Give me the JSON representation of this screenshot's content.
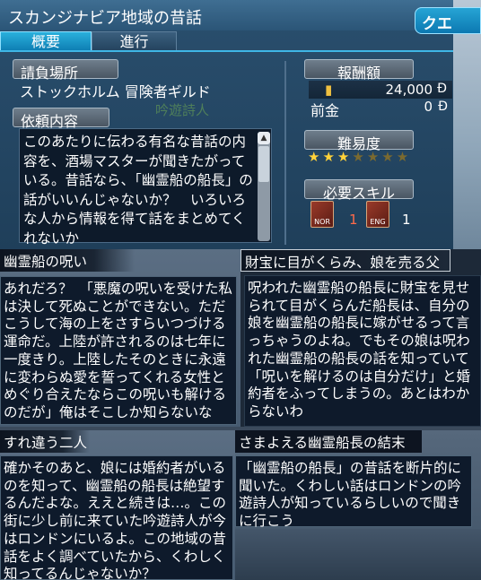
{
  "quest_window": {
    "title": "スカンジナビア地域の昔話",
    "side_tab": "クエ",
    "tabs": {
      "overview": "概要",
      "progress": "進行"
    },
    "client_location_label": "請負場所",
    "client_location": "ストックホルム  冒険者ギルド",
    "request_content_label": "依頼内容",
    "npc_name": "吟遊詩人",
    "description": "このあたりに伝わる有名な昔話の内容を、酒場マスターが聞きたがっている。昔話なら、「幽霊船の船長」の話がいいんじゃないか？　いろいろな人から情報を得て話をまとめてくれないか",
    "reward_label": "報酬額",
    "reward_value": "24,000",
    "advance_label": "前金",
    "advance_value": "0",
    "currency_symbol": "Đ",
    "difficulty_label": "難易度",
    "difficulty": {
      "filled": 3,
      "total": 7
    },
    "skills_label": "必要スキル",
    "skills": [
      {
        "abbr": "NOR",
        "level": "1",
        "color": "#ff6a4a"
      },
      {
        "abbr": "ENG",
        "level": "1",
        "color": "#ffffff"
      }
    ]
  },
  "panels": {
    "curse": {
      "title": "幽霊船の呪い",
      "text": "あれだろ？　「悪魔の呪いを受けた私は決して死ぬことができない。ただこうして海の上をさすらいつづける運命だ。上陸が許されるのは七年に一度きり。上陸したそのときに永遠に変わらぬ愛を誓ってくれる女性とめぐり合えたならこの呪いも解けるのだが」俺はそこしか知らないな"
    },
    "sold": {
      "title": "財宝に目がくらみ、娘を売る父",
      "text": "呪われた幽霊船の船長に財宝を見せられて目がくらんだ船長は、自分の娘を幽霊船の船長に嫁がせるって言っちゃうのよね。でもその娘は呪われた幽霊船の船長の話を知っていて「呪いを解けるのは自分だけ」と婚約者をふってしまうの。あとはわからないわ"
    },
    "passing": {
      "title": "すれ違う二人",
      "text": "確かそのあと、娘には婚約者がいるのを知って、幽霊船の船長は絶望するんだよな。ええと続きは…。この街に少し前に来ていた吟遊詩人が今はロンドンにいるよ。この地域の昔話をよく調べていたから、くわしく知ってるんじゃないか？"
    },
    "end": {
      "title": "さまよえる幽霊船長の結末",
      "text": "「幽霊船の船長」の昔話を断片的に聞いた。くわしい話はロンドンの吟遊詩人が知っているらしいので聞きに行こう"
    }
  },
  "colors": {
    "accent": "#1a9ad0",
    "star": "#ffd23a"
  },
  "icons": {
    "coin": "coin-icon",
    "scroll_up": "scroll-up-arrow-icon"
  }
}
